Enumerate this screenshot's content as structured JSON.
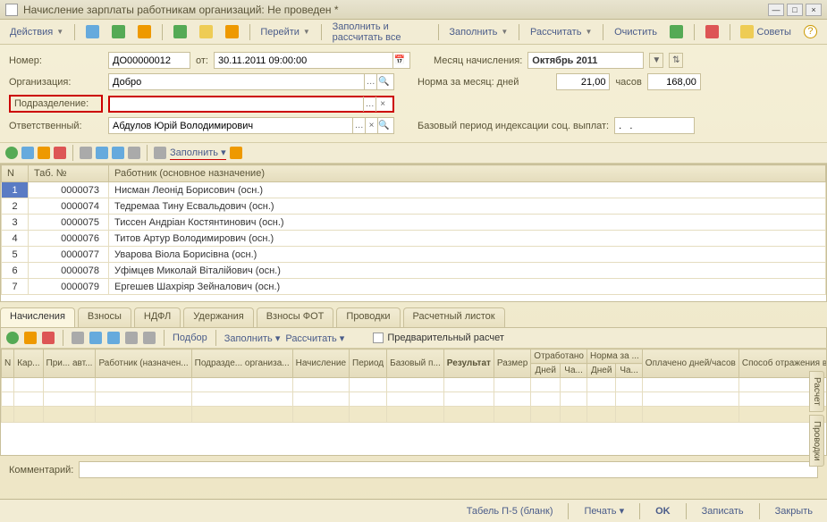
{
  "window": {
    "title": "Начисление зарплаты работникам организаций: Не проведен *"
  },
  "toolbar": {
    "actions": "Действия",
    "goto": "Перейти",
    "fill_calc_all": "Заполнить и рассчитать все",
    "fill": "Заполнить",
    "calc": "Рассчитать",
    "clear": "Очистить",
    "advice": "Советы"
  },
  "form": {
    "number_lbl": "Номер:",
    "number": "ДО00000012",
    "date_lbl": "от:",
    "date": "30.11.2011 09:00:00",
    "month_lbl": "Месяц начисления:",
    "month": "Октябрь 2011",
    "org_lbl": "Организация:",
    "org": "Добро",
    "norm_lbl": "Норма за месяц: дней",
    "norm_days": "21,00",
    "norm_hours_lbl": "часов",
    "norm_hours": "168,00",
    "dept_lbl": "Подразделение:",
    "dept": "",
    "resp_lbl": "Ответственный:",
    "resp": "Абдулов Юрій Володимирович",
    "base_period_lbl": "Базовый период индексации соц. выплат:",
    "base_period": ".   ."
  },
  "mini": {
    "fill": "Заполнить"
  },
  "grid1": {
    "cols": {
      "n": "N",
      "tab": "Таб. №",
      "worker": "Работник (основное назначение)"
    },
    "rows": [
      {
        "n": "1",
        "tab": "0000073",
        "w": "Нисман Леонід Борисович (осн.)"
      },
      {
        "n": "2",
        "tab": "0000074",
        "w": "Тедремаа Тину Есвальдович (осн.)"
      },
      {
        "n": "3",
        "tab": "0000075",
        "w": "Тиссен Андріан Костянтинович (осн.)"
      },
      {
        "n": "4",
        "tab": "0000076",
        "w": "Титов Артур Володимирович (осн.)"
      },
      {
        "n": "5",
        "tab": "0000077",
        "w": "Уварова Віола Борисівна (осн.)"
      },
      {
        "n": "6",
        "tab": "0000078",
        "w": "Уфімцев Миколай Віталійович (осн.)"
      },
      {
        "n": "7",
        "tab": "0000079",
        "w": "Ергешев Шахріяр Зейналович (осн.)"
      }
    ]
  },
  "tabs": {
    "t1": "Начисления",
    "t2": "Взносы",
    "t3": "НДФЛ",
    "t4": "Удержания",
    "t5": "Взносы ФОТ",
    "t6": "Проводки",
    "t7": "Расчетный листок"
  },
  "sub": {
    "select": "Подбор",
    "fill": "Заполнить",
    "calc": "Рассчитать",
    "prelim": "Предварительный расчет"
  },
  "grid2": {
    "cols": {
      "n": "N",
      "kar": "Кар...",
      "pri": "При...\nавт...",
      "worker": "Работник\n(назначен...",
      "dept": "Подразде...\nорганиза...",
      "accrual": "Начисление",
      "period": "Период",
      "base": "Базовый п...",
      "result": "Результат",
      "size": "Размер",
      "worked": "Отработано",
      "norm": "Норма за ...",
      "paid": "Оплачено\nдней/часов",
      "method": "Способ\nотражения\nв бюджете",
      "days": "Дней",
      "hours": "Ча..."
    }
  },
  "side": {
    "calc": "Расчет",
    "post": "Проводки"
  },
  "comment_lbl": "Комментарий:",
  "bottom": {
    "tabel": "Табель П-5 (бланк)",
    "print": "Печать",
    "ok": "OK",
    "save": "Записать",
    "close": "Закрыть"
  }
}
